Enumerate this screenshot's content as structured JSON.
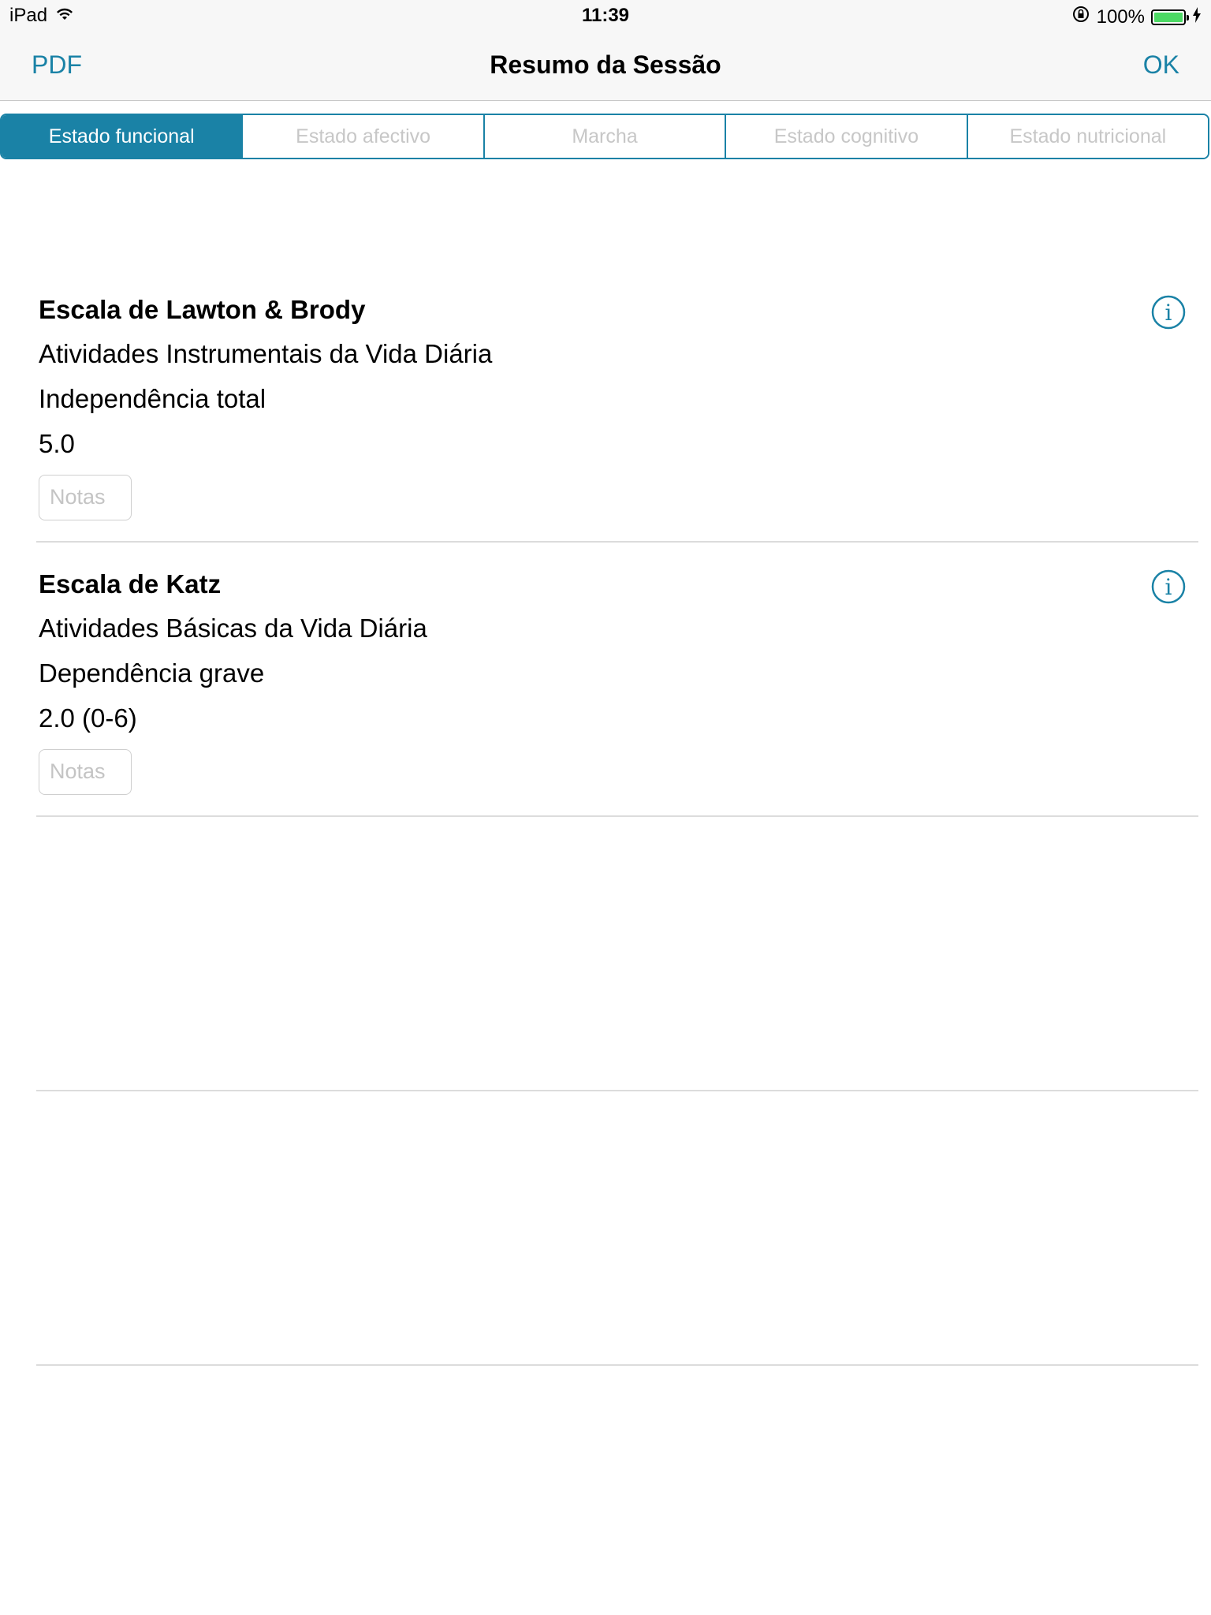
{
  "status_bar": {
    "device": "iPad",
    "time": "11:39",
    "battery": "100%"
  },
  "nav": {
    "left_button": "PDF",
    "title": "Resumo da Sessão",
    "right_button": "OK"
  },
  "tabs": [
    {
      "label": "Estado funcional",
      "active": true
    },
    {
      "label": "Estado afectivo",
      "active": false
    },
    {
      "label": "Marcha",
      "active": false
    },
    {
      "label": "Estado cognitivo",
      "active": false
    },
    {
      "label": "Estado nutricional",
      "active": false
    }
  ],
  "scales": [
    {
      "title": "Escala de Lawton & Brody",
      "subtitle": "Atividades Instrumentais da Vida Diária",
      "result": "Independência total",
      "score": "5.0",
      "notes_placeholder": "Notas"
    },
    {
      "title": "Escala de Katz",
      "subtitle": "Atividades Básicas da Vida Diária",
      "result": "Dependência grave",
      "score": "2.0 (0-6)",
      "notes_placeholder": "Notas"
    }
  ],
  "colors": {
    "accent": "#1a82a6",
    "separator": "#dcdcdc",
    "battery": "#4cd964"
  }
}
